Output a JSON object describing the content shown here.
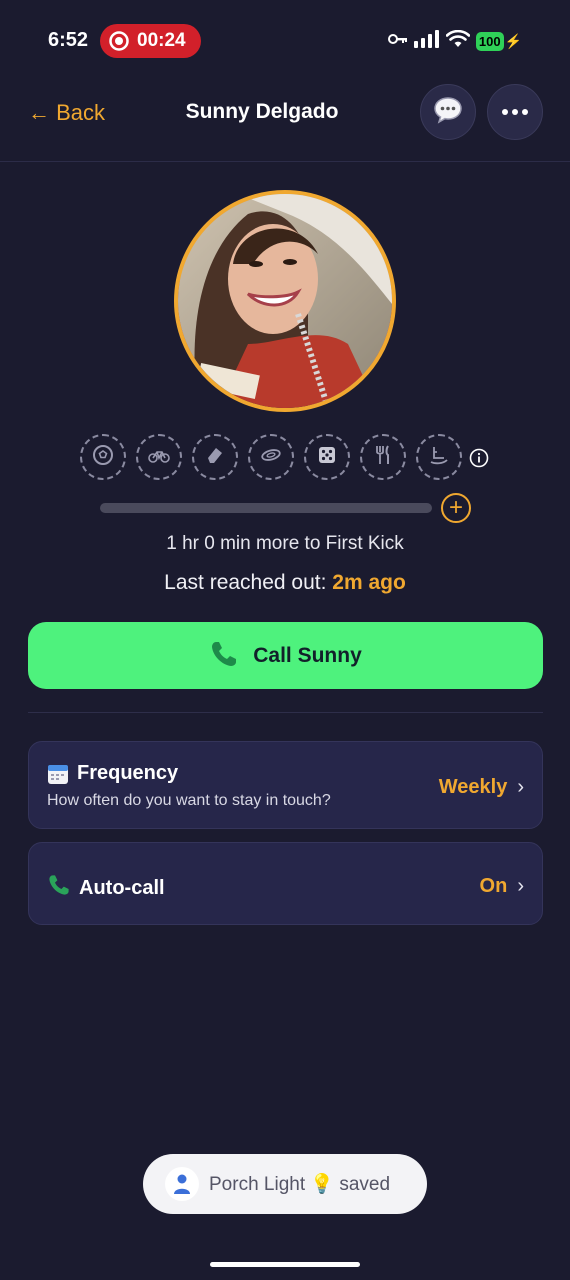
{
  "status_bar": {
    "time": "6:52",
    "recording_timer": "00:24",
    "battery": "100"
  },
  "header": {
    "back_label": "← Back",
    "title": "Sunny Delgado"
  },
  "profile": {
    "activity_icons": [
      "soccer-ball-icon",
      "bicycle-icon",
      "eraser-icon",
      "frisbee-icon",
      "dice-icon",
      "fork-knife-icon",
      "rocking-horse-icon"
    ],
    "progress_fraction": 0.0,
    "next_level_text": "1 hr 0 min more to First Kick",
    "last_reached_label": "Last reached out:",
    "last_reached_value": "2m ago"
  },
  "call_button": {
    "label": "Call Sunny"
  },
  "settings": {
    "frequency": {
      "title": "Frequency",
      "subtitle": "How often do you want to stay in touch?",
      "value": "Weekly"
    },
    "auto_call": {
      "title": "Auto-call",
      "value": "On"
    }
  },
  "toast": {
    "text_before": "Porch Light",
    "emoji": "💡",
    "text_after": "saved"
  },
  "colors": {
    "background": "#1b1b2f",
    "accent": "#f0a830",
    "call_green": "#4ef27d",
    "card": "#26264a",
    "rec_red": "#d2202a"
  }
}
